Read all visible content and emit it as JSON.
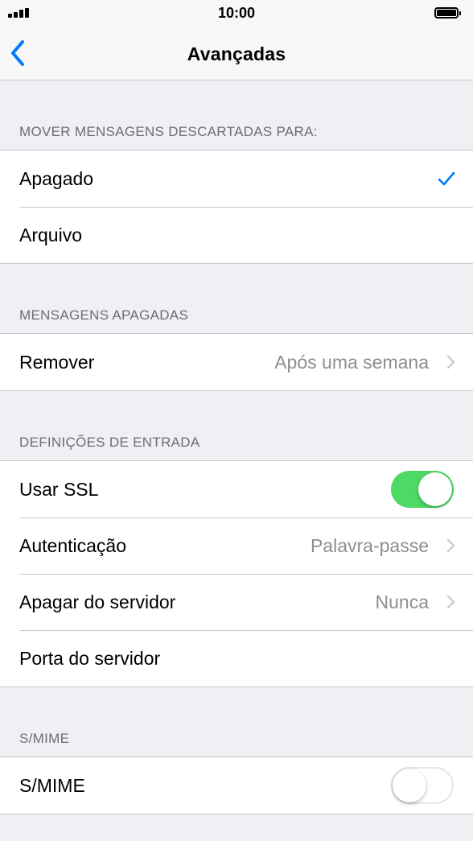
{
  "status_bar": {
    "time": "10:00"
  },
  "nav": {
    "title": "Avançadas",
    "back_icon": "chevron-left-icon"
  },
  "colors": {
    "accent": "#007aff",
    "toggle_on": "#4cd964",
    "background": "#efeff4",
    "secondary_text": "#8e8e93",
    "section_header": "#6d6d72"
  },
  "sections": [
    {
      "header": "MOVER MENSAGENS DESCARTADAS PARA:",
      "rows": [
        {
          "label": "Apagado",
          "checked": true
        },
        {
          "label": "Arquivo",
          "checked": false
        }
      ]
    },
    {
      "header": "MENSAGENS APAGADAS",
      "rows": [
        {
          "label": "Remover",
          "value": "Após uma semana"
        }
      ]
    },
    {
      "header": "DEFINIÇÕES DE ENTRADA",
      "rows": [
        {
          "label": "Usar SSL",
          "toggle": true
        },
        {
          "label": "Autenticação",
          "value": "Palavra-passe"
        },
        {
          "label": "Apagar do servidor",
          "value": "Nunca"
        },
        {
          "label": "Porta do servidor"
        }
      ]
    },
    {
      "header": "S/MIME",
      "rows": [
        {
          "label": "S/MIME",
          "toggle": false
        }
      ]
    }
  ]
}
